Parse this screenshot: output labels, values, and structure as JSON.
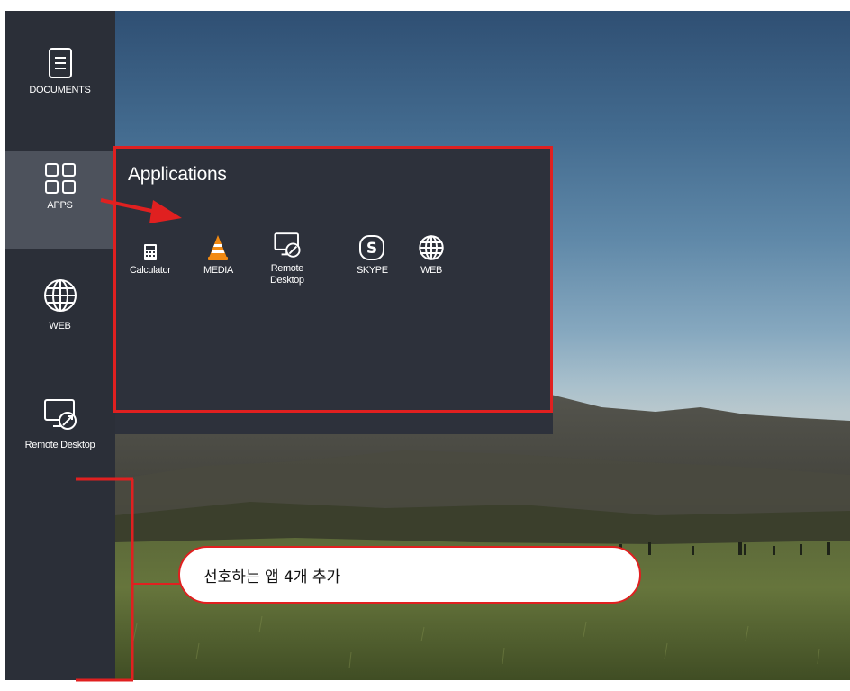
{
  "sidebar": {
    "items": [
      {
        "label": "DOCUMENTS",
        "icon": "document-icon"
      },
      {
        "label": "APPS",
        "icon": "apps-grid-icon"
      },
      {
        "label": "WEB",
        "icon": "globe-icon"
      },
      {
        "label": "Remote Desktop",
        "icon": "remote-desktop-icon"
      }
    ],
    "selected": "APPS"
  },
  "apps_panel": {
    "title": "Applications",
    "apps": [
      {
        "label": "Calculator",
        "icon": "calculator-icon"
      },
      {
        "label": "MEDIA",
        "icon": "vlc-cone-icon"
      },
      {
        "label": "Remote\nDesktop",
        "icon": "remote-desktop-icon"
      },
      {
        "label": "SKYPE",
        "icon": "skype-icon"
      },
      {
        "label": "WEB",
        "icon": "globe-icon"
      }
    ]
  },
  "annotation": {
    "callout_text": "선호하는 앱 4개 추가"
  },
  "colors": {
    "sidebar_bg": "#2b2f38",
    "selected_item_bg": "#4d525c",
    "panel_bg": "#2d313b",
    "annotation_red": "#e02020",
    "vlc_orange": "#f28a12"
  }
}
